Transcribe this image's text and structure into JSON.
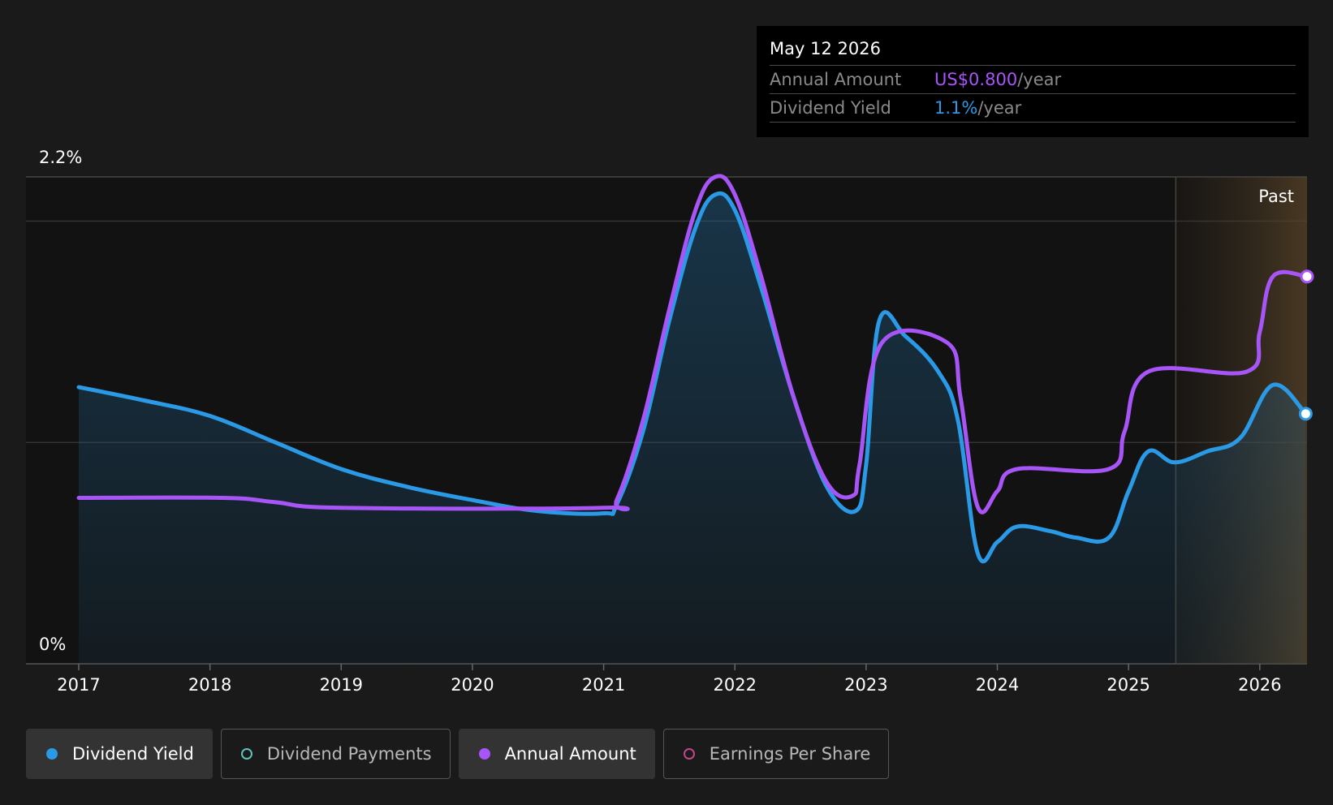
{
  "tooltip": {
    "date": "May 12 2026",
    "rows": [
      {
        "label": "Annual Amount",
        "value": "US$0.800",
        "unit": "/year",
        "color": "#a855f7"
      },
      {
        "label": "Dividend Yield",
        "value": "1.1%",
        "unit": "/year",
        "color": "#2b9ae6"
      }
    ]
  },
  "legend": [
    {
      "label": "Dividend Yield",
      "color": "#2b9ae6",
      "active": true,
      "icon": "filled-dot-icon"
    },
    {
      "label": "Dividend Payments",
      "color": "#5ec4b6",
      "active": false,
      "icon": "hollow-dot-icon"
    },
    {
      "label": "Annual Amount",
      "color": "#a855f7",
      "active": true,
      "icon": "filled-dot-icon"
    },
    {
      "label": "Earnings Per Share",
      "color": "#c2478a",
      "active": false,
      "icon": "hollow-dot-icon"
    }
  ],
  "chart_data": {
    "type": "line",
    "x_ticks": [
      "2017",
      "2018",
      "2019",
      "2020",
      "2021",
      "2022",
      "2023",
      "2024",
      "2025",
      "2026"
    ],
    "y_tick_labels": {
      "max": "2.2%",
      "min": "0%"
    },
    "xlim": [
      2017.0,
      2026.36
    ],
    "ylim": [
      0,
      2.2
    ],
    "grid_lines_y": [
      1.0,
      2.0
    ],
    "past_region": {
      "label": "Past",
      "from": 2025.36,
      "to": 2026.36
    },
    "series": [
      {
        "name": "Dividend Yield",
        "color": "#2b9ae6",
        "area": true,
        "points": [
          [
            2017.0,
            1.25
          ],
          [
            2017.5,
            1.19
          ],
          [
            2018.0,
            1.12
          ],
          [
            2018.5,
            1.0
          ],
          [
            2019.0,
            0.88
          ],
          [
            2019.5,
            0.8
          ],
          [
            2020.0,
            0.74
          ],
          [
            2020.5,
            0.69
          ],
          [
            2021.0,
            0.68
          ],
          [
            2021.1,
            0.72
          ],
          [
            2021.3,
            1.05
          ],
          [
            2021.5,
            1.55
          ],
          [
            2021.7,
            1.97
          ],
          [
            2021.85,
            2.12
          ],
          [
            2022.0,
            2.05
          ],
          [
            2022.2,
            1.7
          ],
          [
            2022.45,
            1.2
          ],
          [
            2022.7,
            0.8
          ],
          [
            2022.92,
            0.69
          ],
          [
            2023.0,
            0.9
          ],
          [
            2023.1,
            1.55
          ],
          [
            2023.3,
            1.48
          ],
          [
            2023.55,
            1.32
          ],
          [
            2023.7,
            1.1
          ],
          [
            2023.85,
            0.5
          ],
          [
            2024.0,
            0.55
          ],
          [
            2024.15,
            0.62
          ],
          [
            2024.4,
            0.6
          ],
          [
            2024.6,
            0.57
          ],
          [
            2024.85,
            0.57
          ],
          [
            2025.0,
            0.78
          ],
          [
            2025.15,
            0.96
          ],
          [
            2025.35,
            0.91
          ],
          [
            2025.6,
            0.96
          ],
          [
            2025.85,
            1.02
          ],
          [
            2026.1,
            1.26
          ],
          [
            2026.35,
            1.13
          ]
        ]
      },
      {
        "name": "Annual Amount",
        "color": "#a855f7",
        "area": false,
        "points": [
          [
            2017.0,
            0.75
          ],
          [
            2018.1,
            0.75
          ],
          [
            2018.5,
            0.73
          ],
          [
            2019.0,
            0.705
          ],
          [
            2021.0,
            0.705
          ],
          [
            2021.1,
            0.74
          ],
          [
            2021.3,
            1.1
          ],
          [
            2021.5,
            1.6
          ],
          [
            2021.7,
            2.05
          ],
          [
            2021.85,
            2.2
          ],
          [
            2022.0,
            2.12
          ],
          [
            2022.2,
            1.75
          ],
          [
            2022.45,
            1.2
          ],
          [
            2022.7,
            0.82
          ],
          [
            2022.9,
            0.76
          ],
          [
            2022.95,
            0.9
          ],
          [
            2023.12,
            1.45
          ],
          [
            2023.62,
            1.45
          ],
          [
            2023.72,
            1.2
          ],
          [
            2023.85,
            0.71
          ],
          [
            2024.0,
            0.78
          ],
          [
            2024.15,
            0.88
          ],
          [
            2024.85,
            0.88
          ],
          [
            2024.97,
            1.05
          ],
          [
            2025.15,
            1.32
          ],
          [
            2025.9,
            1.32
          ],
          [
            2026.0,
            1.5
          ],
          [
            2026.1,
            1.75
          ],
          [
            2026.36,
            1.75
          ]
        ]
      }
    ]
  }
}
